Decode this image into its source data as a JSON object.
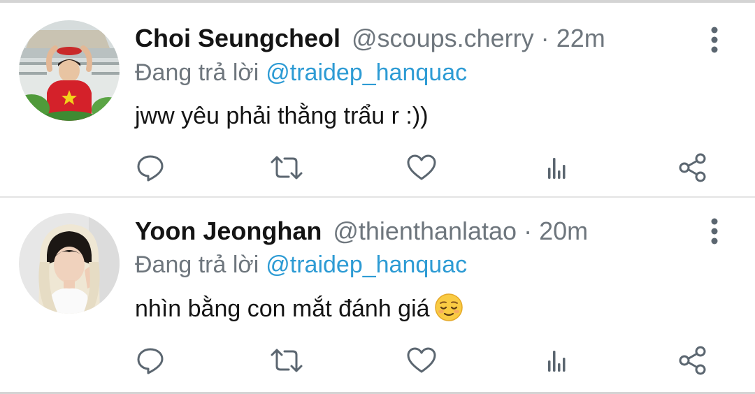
{
  "colors": {
    "name": "#141414",
    "secondary": "#6e767d",
    "mention": "#2d9bd4",
    "icon": "#5b6670"
  },
  "tweets": [
    {
      "display_name": "Choi Seungcheol",
      "handle": "@scoups.cherry",
      "separator": "·",
      "time": "22m",
      "reply_prefix": "Đang trả lời",
      "reply_to": "@traidep_hanquac",
      "text": "jww yêu phải thằng trẩu r :))",
      "emoji": ""
    },
    {
      "display_name": "Yoon Jeonghan",
      "handle": "@thienthanlatao",
      "separator": "·",
      "time": "20m",
      "reply_prefix": "Đang trả lời",
      "reply_to": "@traidep_hanquac",
      "text": "nhìn bằng con mắt đánh giá",
      "emoji": "relieved-face"
    }
  ],
  "icons": {
    "more": "more-vertical-icon",
    "reply": "reply-bubble-icon",
    "retweet": "retweet-icon",
    "like": "heart-icon",
    "stats": "analytics-bars-icon",
    "share": "share-icon"
  }
}
